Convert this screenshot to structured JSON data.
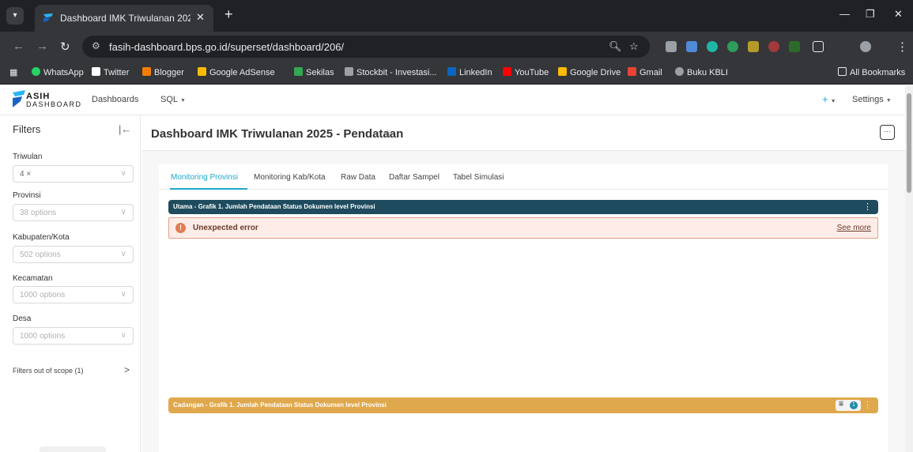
{
  "browser": {
    "tab_title": "Dashboard IMK Triwulanan 202",
    "url": "fasih-dashboard.bps.go.id/superset/dashboard/206/",
    "bookmarks": [
      {
        "label": "WhatsApp",
        "color": "#25d366"
      },
      {
        "label": "Twitter",
        "color": "#ffffff"
      },
      {
        "label": "Blogger",
        "color": "#f57d00"
      },
      {
        "label": "Google AdSense",
        "color": "#fbbc04"
      },
      {
        "label": "Sekilas",
        "color": "#34a853"
      },
      {
        "label": "Stockbit - Investasi...",
        "color": "#9aa0a6"
      },
      {
        "label": "LinkedIn",
        "color": "#0a66c2"
      },
      {
        "label": "YouTube",
        "color": "#ff0000"
      },
      {
        "label": "Google Drive",
        "color": "#fbbc04"
      },
      {
        "label": "Gmail",
        "color": "#ea4335"
      },
      {
        "label": "Buku KBLI",
        "color": "#9aa0a6"
      }
    ],
    "all_bookmarks": "All Bookmarks"
  },
  "app": {
    "logo_line1": "ASIH",
    "logo_line2": "DASHBOARD",
    "nav_dashboards": "Dashboards",
    "nav_sql": "SQL",
    "nav_plus": "+",
    "nav_settings": "Settings"
  },
  "filters": {
    "title": "Filters",
    "items": [
      {
        "label": "Triwulan",
        "value": "4 ×"
      },
      {
        "label": "Provinsi",
        "value": "38 options"
      },
      {
        "label": "Kabupaten/Kota",
        "value": "502 options"
      },
      {
        "label": "Kecamatan",
        "value": "1000 options"
      },
      {
        "label": "Desa",
        "value": "1000 options"
      }
    ],
    "out_of_scope": "Filters out of scope (1)"
  },
  "dashboard": {
    "title": "Dashboard IMK Triwulanan 2025 - Pendataan",
    "menu": "···",
    "tabs": [
      "Monitoring Provinsi",
      "Monitoring Kab/Kota",
      "Raw Data",
      "Daftar Sampel",
      "Tabel Simulasi"
    ],
    "chart1_title": "Utama - Grafik 1. Jumlah Pendataan Status Dokumen level Provinsi",
    "error_text": "Unexpected error",
    "see_more": "See more",
    "chart2_title": "Cadangan - Grafik 1. Jumlah Pendataan Status Dokumen level Provinsi",
    "filter_badge": "1"
  },
  "colors": {
    "accent": "#20a7c9",
    "chart1_header": "#1e4b5e",
    "chart2_header": "#e0a84c",
    "error_bg": "#fdece7"
  }
}
